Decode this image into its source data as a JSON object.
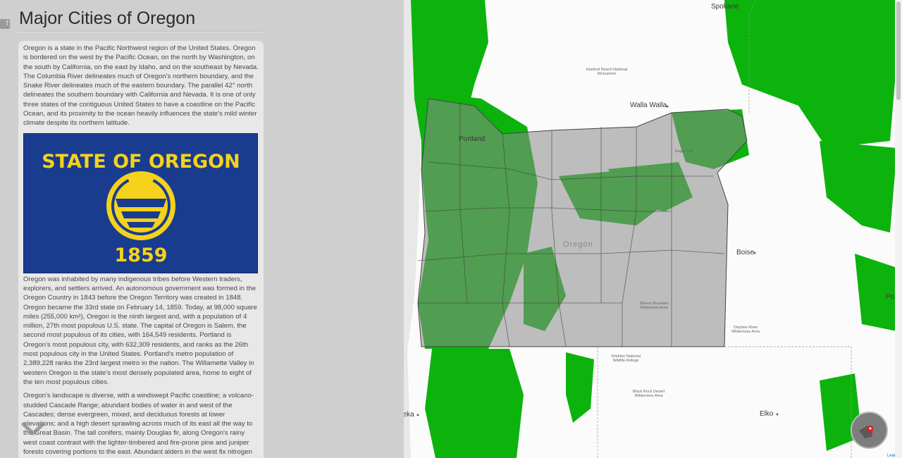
{
  "page": {
    "title": "Major Cities of Oregon",
    "share_icon": "facebook-icon",
    "scroll_icon": "chevron-down-icon"
  },
  "panel": {
    "paragraphs": [
      "Oregon is a state in the Pacific Northwest region of the United States. Oregon is bordered on the west by the Pacific Ocean, on the north by Washington, on the south by California, on the east by Idaho, and on the southeast by Nevada. The Columbia River delineates much of Oregon's northern boundary, and the Snake River delineates much of the eastern boundary. The parallel 42° north delineates the southern boundary with California and Nevada. It is one of only three states of the contiguous United States to have a coastline on the Pacific Ocean, and its proximity to the ocean heavily influences the state's mild winter climate despite its northern latitude.",
      "Oregon was inhabited by many indigenous tribes before Western traders, explorers, and settlers arrived. An autonomous government was formed in the Oregon Country in 1843 before the Oregon Territory was created in 1848. Oregon became the 33rd state on February 14, 1859. Today, at 98,000 square miles (255,000 km²), Oregon is the ninth largest and, with a population of 4 million, 27th most populous U.S. state. The capital of Oregon is Salem, the second most populous of its cities, with 164,549 residents. Portland is Oregon's most populous city, with 632,309 residents, and ranks as the 26th most populous city in the United States. Portland's metro population of 2,389,228 ranks the 23rd largest metro in the nation. The Willamette Valley in western Oregon is the state's most densely populated area, home to eight of the ten most populous cities.",
      "Oregon's landscape is diverse, with a windswept Pacific coastline; a volcano-studded Cascade Range; abundant bodies of water in and west of the Cascades; dense evergreen, mixed, and deciduous forests at lower elevations; and a high desert sprawling across much of its east all the way to the Great Basin. The tall conifers, mainly Douglas fir, along Oregon's rainy west coast contrast with the lighter-timbered and fire-prone pine and juniper forests covering portions to the east. Abundant alders in the west fix nitrogen for the"
    ],
    "flag": {
      "top_text": "STATE OF OREGON",
      "year": "1859",
      "background": "#1a3c8e",
      "gold": "#f5d21b"
    }
  },
  "map": {
    "colors": {
      "forest": "#0cb30c",
      "land": "#fbfbfb",
      "oregon_overlay": "#a8a8a8"
    },
    "labels": {
      "spokane": "Spokane",
      "hanford": "Hanford Reach National Monument",
      "walla_walla": "Walla Walla",
      "portland": "Portland",
      "eagle_cap": "Eagle Cap",
      "oregon": "Oregon",
      "boise": "Boise",
      "steens": "Steens Mountain Wilderness Area",
      "owyhee": "Owyhee River Wilderness Area",
      "sheldon": "Sheldon National Wildlife Refuge",
      "black_rock": "Black Rock Desert Wilderness Area",
      "eureka": "Eureka",
      "elko": "Elko",
      "po": "Po"
    },
    "attribution": "Leaflet",
    "minimap_icon": "location-pin-icon"
  }
}
